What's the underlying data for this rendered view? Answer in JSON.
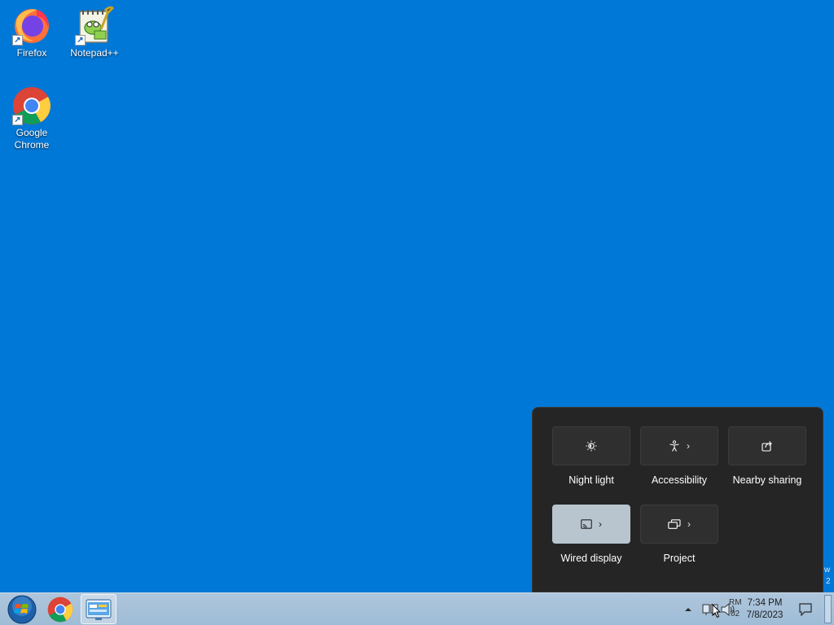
{
  "desktop": {
    "icons": [
      {
        "label": "Firefox",
        "icon": "firefox-icon"
      },
      {
        "label": "Notepad++",
        "icon": "notepad-plus-plus-icon"
      },
      {
        "label": "Google Chrome",
        "icon": "chrome-icon"
      }
    ]
  },
  "quick_settings": {
    "tiles": [
      {
        "label": "Night light",
        "icon": "night-light-icon",
        "has_chevron": false,
        "active": false
      },
      {
        "label": "Accessibility",
        "icon": "accessibility-icon",
        "has_chevron": true,
        "active": false
      },
      {
        "label": "Nearby sharing",
        "icon": "share-icon",
        "has_chevron": false,
        "active": false
      },
      {
        "label": "Wired display",
        "icon": "cast-icon",
        "has_chevron": true,
        "active": true
      },
      {
        "label": "Project",
        "icon": "project-icon",
        "has_chevron": true,
        "active": false
      }
    ],
    "chevron": "›"
  },
  "taskbar": {
    "pinned": [
      "start-orb-icon",
      "chrome-icon",
      "control-panel-icon"
    ],
    "clock_time": "7:34 PM",
    "clock_date": "7/8/2023",
    "partial_text_1": "RM",
    "partial_text_2": "02",
    "partial_text_3": "w",
    "partial_text_4": "2"
  },
  "colors": {
    "desktop": "#0078d7",
    "flyout": "#252525",
    "tile": "#2f2f2f",
    "tile_active": "#b8c5cf",
    "taskbar": "#aec6dc"
  }
}
